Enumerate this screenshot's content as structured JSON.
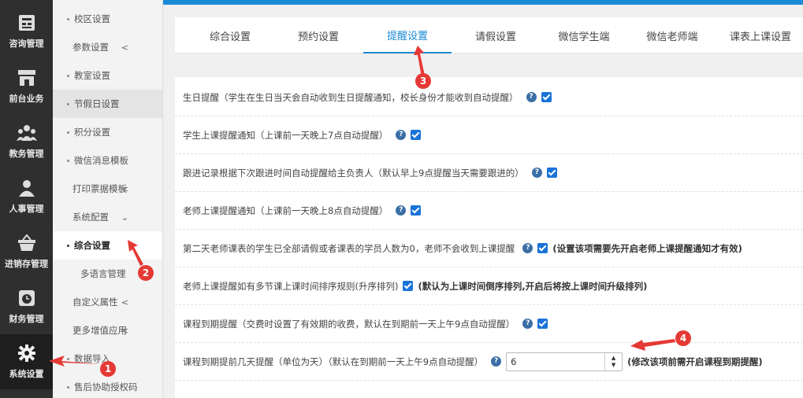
{
  "nav": [
    {
      "label": "咨询管理",
      "icon": "register-icon"
    },
    {
      "label": "前台业务",
      "icon": "store-icon"
    },
    {
      "label": "教务管理",
      "icon": "group-icon"
    },
    {
      "label": "人事管理",
      "icon": "person-icon"
    },
    {
      "label": "进销存管理",
      "icon": "basket-icon"
    },
    {
      "label": "财务管理",
      "icon": "clock-icon"
    },
    {
      "label": "系统设置",
      "icon": "gear-icon"
    }
  ],
  "submenu": {
    "items": [
      {
        "label": "校区设置"
      },
      {
        "label": "参数设置"
      },
      {
        "label": "教室设置"
      },
      {
        "label": "节假日设置"
      },
      {
        "label": "积分设置"
      },
      {
        "label": "微信消息模板"
      },
      {
        "label": "打印票据模板"
      },
      {
        "label": "系统配置"
      },
      {
        "label": "综合设置"
      },
      {
        "label": "多语言管理"
      },
      {
        "label": "自定义属性"
      },
      {
        "label": "更多增值应用"
      },
      {
        "label": "数据导入"
      },
      {
        "label": "售后协助授权码"
      }
    ]
  },
  "tabs": [
    {
      "label": "综合设置"
    },
    {
      "label": "预约设置"
    },
    {
      "label": "提醒设置"
    },
    {
      "label": "请假设置"
    },
    {
      "label": "微信学生端"
    },
    {
      "label": "微信老师端"
    },
    {
      "label": "课表上课设置"
    }
  ],
  "settings": {
    "help_glyph": "?",
    "rows": [
      {
        "text": "生日提醒（学生在生日当天会自动收到生日提醒通知，校长身份才能收到自动提醒）",
        "checked": true
      },
      {
        "text": "学生上课提醒通知（上课前一天晚上7点自动提醒）",
        "checked": true
      },
      {
        "text": "跟进记录根据下次跟进时间自动提醒给主负责人（默认早上9点提醒当天需要跟进的）",
        "checked": true
      },
      {
        "text": "老师上课提醒通知（上课前一天晚上8点自动提醒）",
        "checked": true
      },
      {
        "text": "第二天老师课表的学生已全部请假或者课表的学员人数为0，老师不会收到上课提醒",
        "checked": true,
        "note": "(设置该项需要先开启老师上课提醒通知才有效)"
      },
      {
        "text": "老师上课提醒如有多节课上课时间排序规则(升序排列)",
        "checked": true,
        "note": "(默认为上课时间倒序排列,开启后将按上课时间升级排列)"
      },
      {
        "text": "课程到期提醒（交费时设置了有效期的收费，默认在到期前一天上午9点自动提醒）",
        "checked": true
      },
      {
        "text": "课程到期提前几天提醒（单位为天）（默认在到期前一天上午9点自动提醒）",
        "input_value": "6",
        "note": "(修改该项前需开启课程到期提醒)"
      }
    ]
  },
  "annotations": [
    "1",
    "2",
    "3",
    "4"
  ],
  "colors": {
    "accent": "#1a8bd6",
    "badge": "#e53935",
    "checkbox": "#1a73d9",
    "sidebar": "#2f2f2f"
  }
}
